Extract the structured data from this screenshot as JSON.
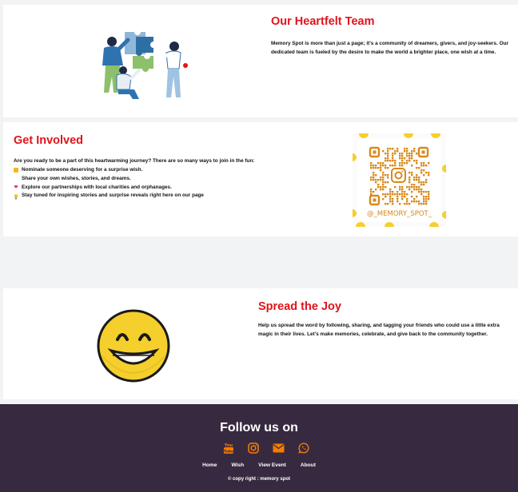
{
  "team": {
    "title": "Our Heartfelt Team",
    "text": "Memory Spot is more than just a page; it's a community of dreamers, givers, and joy-seekers. Our dedicated team is fueled by the desire to make the world a brighter place, one wish at a time."
  },
  "involved": {
    "title": "Get Involved",
    "intro": "Are you ready to be a part of this heartwarming journey? There are so many ways to join in the fun:",
    "items": [
      {
        "icon": "star-struck-emoji",
        "text": "Nominate someone deserving for a surprise wish."
      },
      {
        "icon": "blank-emoji",
        "text": "Share your own wishes, stories, and dreams."
      },
      {
        "icon": "heart-emoji",
        "text": "Explore our partnerships with local charities and orphanages."
      },
      {
        "icon": "lightbulb-emoji",
        "text": "Stay tuned for inspiring stories and surprise reveals right here on our page"
      }
    ],
    "qr_handle": "@_MEMORY_SPOT_"
  },
  "joy": {
    "title": "Spread the Joy",
    "text": "Help us spread the word by following, sharing, and tagging your friends who could use a little extra magic in their lives. Let's make memories, celebrate, and give back to the community together."
  },
  "footer": {
    "title": "Follow us on",
    "social_icons": [
      "youtube-icon",
      "instagram-icon",
      "email-icon",
      "whatsapp-icon"
    ],
    "nav": [
      "Home",
      "Wish",
      "View Event",
      "About"
    ],
    "copyright": "© copy right : memory spot"
  },
  "colors": {
    "heading": "#e0141a",
    "footer_bg": "#372a40",
    "social_orange": "#f57c00",
    "qr_orange": "#d8891b",
    "page_bg": "#f2f3f4"
  }
}
